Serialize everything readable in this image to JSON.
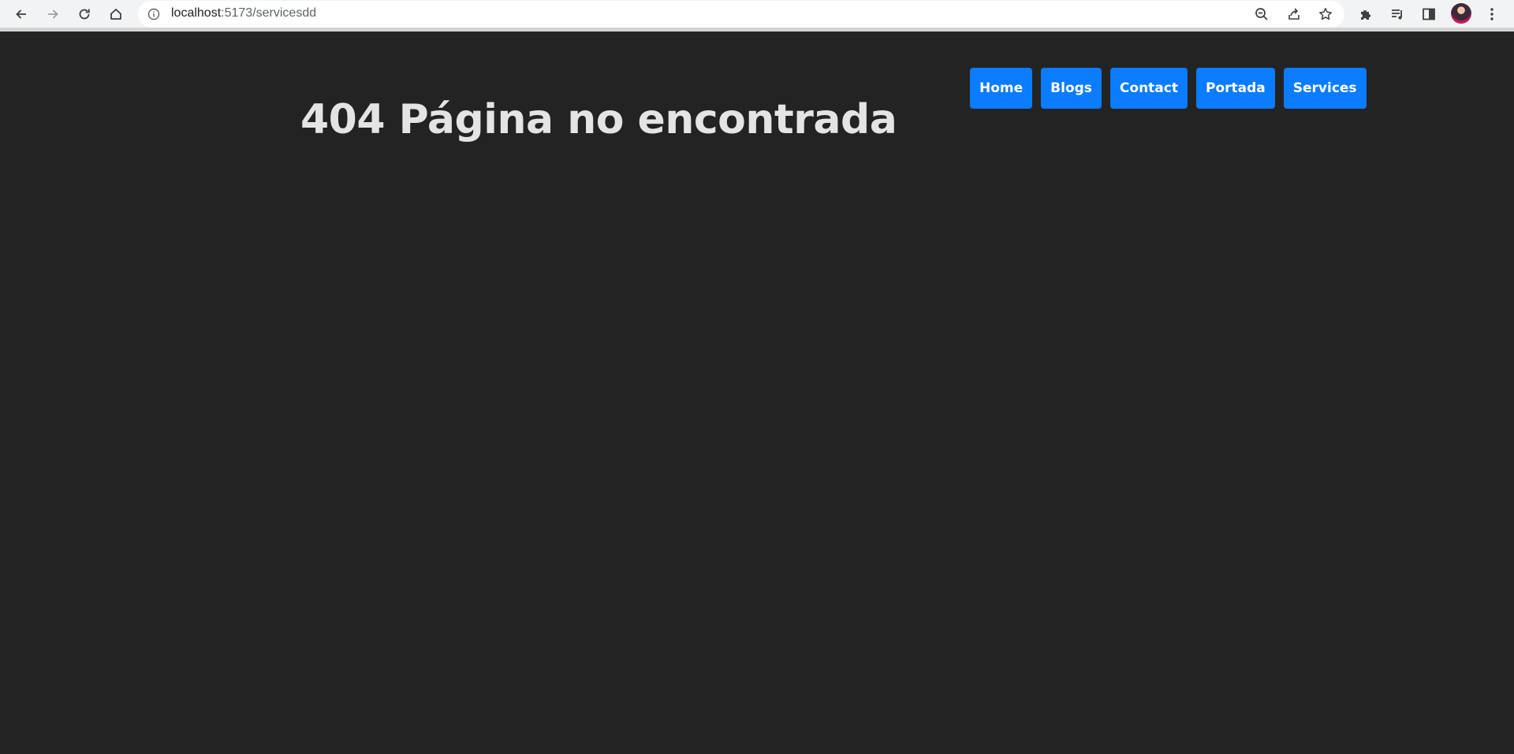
{
  "browser": {
    "url_host": "localhost",
    "url_path": ":5173/servicesdd",
    "icons": {
      "back": "back-arrow-icon",
      "forward": "forward-arrow-icon",
      "reload": "reload-icon",
      "home": "home-icon",
      "site_info": "info-icon",
      "zoom": "zoom-out-icon",
      "share": "share-icon",
      "bookmark": "star-icon",
      "extensions": "puzzle-icon",
      "reading_list": "reading-list-icon",
      "side_panel": "side-panel-icon",
      "profile": "avatar",
      "menu": "kebab-menu-icon"
    }
  },
  "page": {
    "heading": "404 Página no encontrada",
    "nav": [
      {
        "label": "Home"
      },
      {
        "label": "Blogs"
      },
      {
        "label": "Contact"
      },
      {
        "label": "Portada"
      },
      {
        "label": "Services"
      }
    ]
  },
  "colors": {
    "background": "#232323",
    "heading": "#e4e4e4",
    "nav_button": "#0a7cff",
    "nav_text": "#ffffff"
  }
}
